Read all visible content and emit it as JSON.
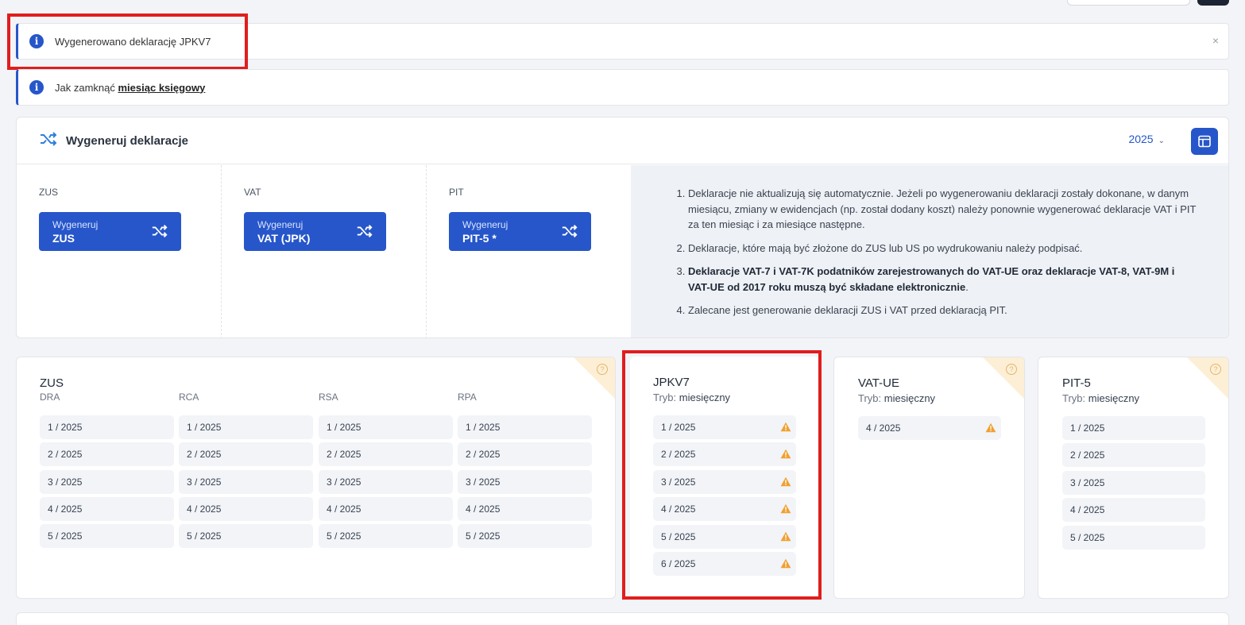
{
  "alerts": {
    "generated": "Wygenerowano deklarację JPKV7",
    "close": "×",
    "howto_prefix": "Jak zamknąć",
    "howto_link": "miesiąc księgowy"
  },
  "generate": {
    "title": "Wygeneruj deklaracje",
    "year": "2025",
    "year_chevron": "⌄",
    "columns": [
      {
        "label": "ZUS",
        "btn_small": "Wygeneruj",
        "btn_big": "ZUS"
      },
      {
        "label": "VAT",
        "btn_small": "Wygeneruj",
        "btn_big": "VAT (JPK)"
      },
      {
        "label": "PIT",
        "btn_small": "Wygeneruj",
        "btn_big": "PIT-5 *"
      }
    ],
    "notes": [
      "Deklaracje nie aktualizują się automatycznie. Jeżeli po wygenerowaniu deklaracji zostały dokonane, w danym miesiącu, zmiany w ewidencjach (np. został dodany koszt) należy ponownie wygenerować deklaracje VAT i PIT za ten miesiąc i za miesiące następne.",
      "Deklaracje, które mają być złożone do ZUS lub US po wydrukowaniu należy podpisać.",
      {
        "bold": "Deklaracje VAT-7 i VAT-7K podatników zarejestrowanych do VAT-UE oraz deklaracje VAT-8, VAT-9M i VAT-UE od 2017 roku muszą być składane elektronicznie",
        "tail": "."
      },
      "Zalecane jest generowanie deklaracji ZUS i VAT przed deklaracją PIT."
    ]
  },
  "cards": {
    "zus": {
      "title": "ZUS",
      "help": "?",
      "columns": [
        {
          "label": "DRA",
          "items": [
            "1 / 2025",
            "2 / 2025",
            "3 / 2025",
            "4 / 2025",
            "5 / 2025"
          ]
        },
        {
          "label": "RCA",
          "items": [
            "1 / 2025",
            "2 / 2025",
            "3 / 2025",
            "4 / 2025",
            "5 / 2025"
          ]
        },
        {
          "label": "RSA",
          "items": [
            "1 / 2025",
            "2 / 2025",
            "3 / 2025",
            "4 / 2025",
            "5 / 2025"
          ]
        },
        {
          "label": "RPA",
          "items": [
            "1 / 2025",
            "2 / 2025",
            "3 / 2025",
            "4 / 2025",
            "5 / 2025"
          ]
        }
      ]
    },
    "jpk": {
      "title": "JPKV7",
      "mode_label": "Tryb:",
      "mode_value": "miesięczny",
      "items": [
        "1 / 2025",
        "2 / 2025",
        "3 / 2025",
        "4 / 2025",
        "5 / 2025",
        "6 / 2025"
      ]
    },
    "vatue": {
      "title": "VAT-UE",
      "help": "?",
      "mode_label": "Tryb:",
      "mode_value": "miesięczny",
      "items": [
        "4 / 2025"
      ]
    },
    "pit": {
      "title": "PIT-5",
      "help": "?",
      "mode_label": "Tryb:",
      "mode_value": "miesięczny",
      "items": [
        "1 / 2025",
        "2 / 2025",
        "3 / 2025",
        "4 / 2025",
        "5 / 2025"
      ]
    }
  },
  "colors": {
    "accent": "#2656c9",
    "highlight": "#e11d1d",
    "warning": "#f0a030"
  }
}
